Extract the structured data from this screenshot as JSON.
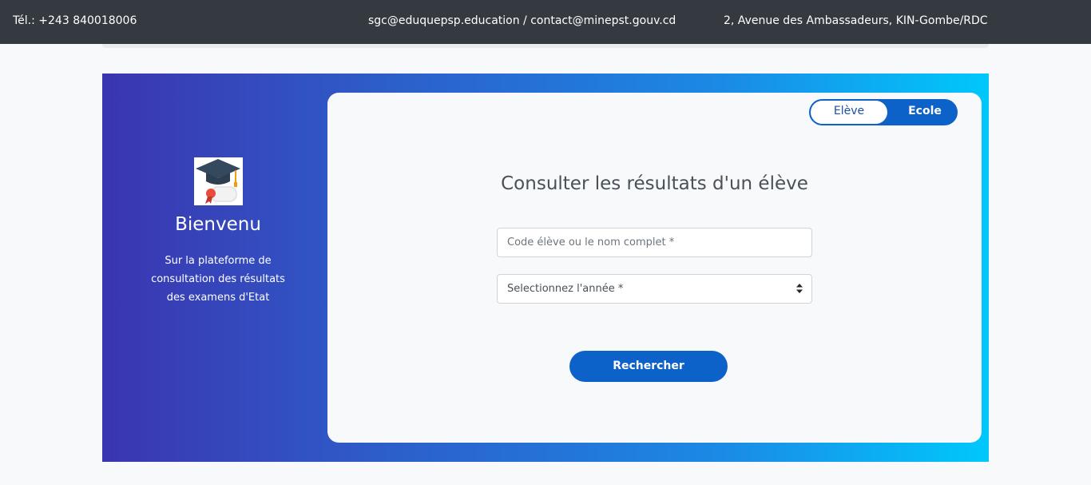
{
  "topbar": {
    "phone": "Tél.: +243 840018006",
    "emails": "sgc@eduquepsp.education / contact@minepst.gouv.cd",
    "address": "2, Avenue des Ambassadeurs, KIN-Gombe/RDC"
  },
  "welcome": {
    "logo_icon": "graduation-cap-diploma-icon",
    "title": "Bienvenu",
    "text": "Sur la plateforme de consultation des résultats des examens d'Etat"
  },
  "toggle": {
    "options": [
      "Elève",
      "Ecole"
    ],
    "selected": "Elève"
  },
  "form": {
    "title": "Consulter les résultats d'un élève",
    "code_placeholder": "Code élève ou le nom complet *",
    "year_value": "Selectionnez l'année *",
    "submit_label": "Rechercher"
  },
  "colors": {
    "topbar": "#343a40",
    "accent": "#0d62c9",
    "gradient_start": "#3b35b0",
    "gradient_end": "#00c8fb"
  }
}
